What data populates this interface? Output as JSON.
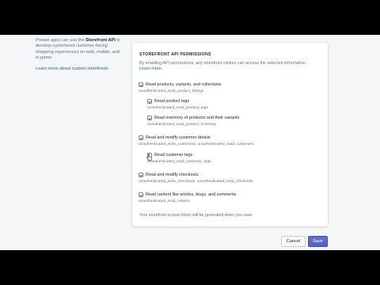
{
  "aside": {
    "text_before": "Private apps can use the ",
    "strong": "Storefront API",
    "text_after": " to develop customized customer-facing shopping experiences on web, mobile, and in-game.",
    "learn_link": "Learn more about custom storefronts"
  },
  "section": {
    "title": "STOREFRONT API PERMISSIONS",
    "description": "By enabling API permissions, any storefront visitors can access the selected information.",
    "learn_more": "Learn more."
  },
  "permissions": [
    {
      "label": "Read products, variants, and collections",
      "scope": "unauthenticated_read_product_listings",
      "checked": true
    },
    {
      "label": "Read product tags",
      "scope": "unauthenticated_read_product_tags",
      "checked": true
    },
    {
      "label": "Read inventory of products and their variants",
      "scope": "unauthenticated_read_product_inventory",
      "checked": true
    },
    {
      "label": "Read and modify customer details",
      "scope": "unauthenticated_write_customers, unauthenticated_read_customers",
      "checked": true
    },
    {
      "label": "Read customer tags",
      "scope": "unauthenticated_read_customer_tags",
      "checked": false
    },
    {
      "label": "Read and modify checkouts",
      "scope": "unauthenticated_write_checkouts, unauthenticated_read_checkouts",
      "checked": true
    },
    {
      "label": "Read content like articles, blogs, and comments",
      "scope": "unauthenticated_read_content",
      "checked": true
    }
  ],
  "footnote": "Your storefront access token will be generated when you save.",
  "actions": {
    "cancel": "Cancel",
    "save": "Save"
  },
  "colors": {
    "accent": "#5c6ac4",
    "link": "#006fbb",
    "background": "#f4f6f8"
  }
}
